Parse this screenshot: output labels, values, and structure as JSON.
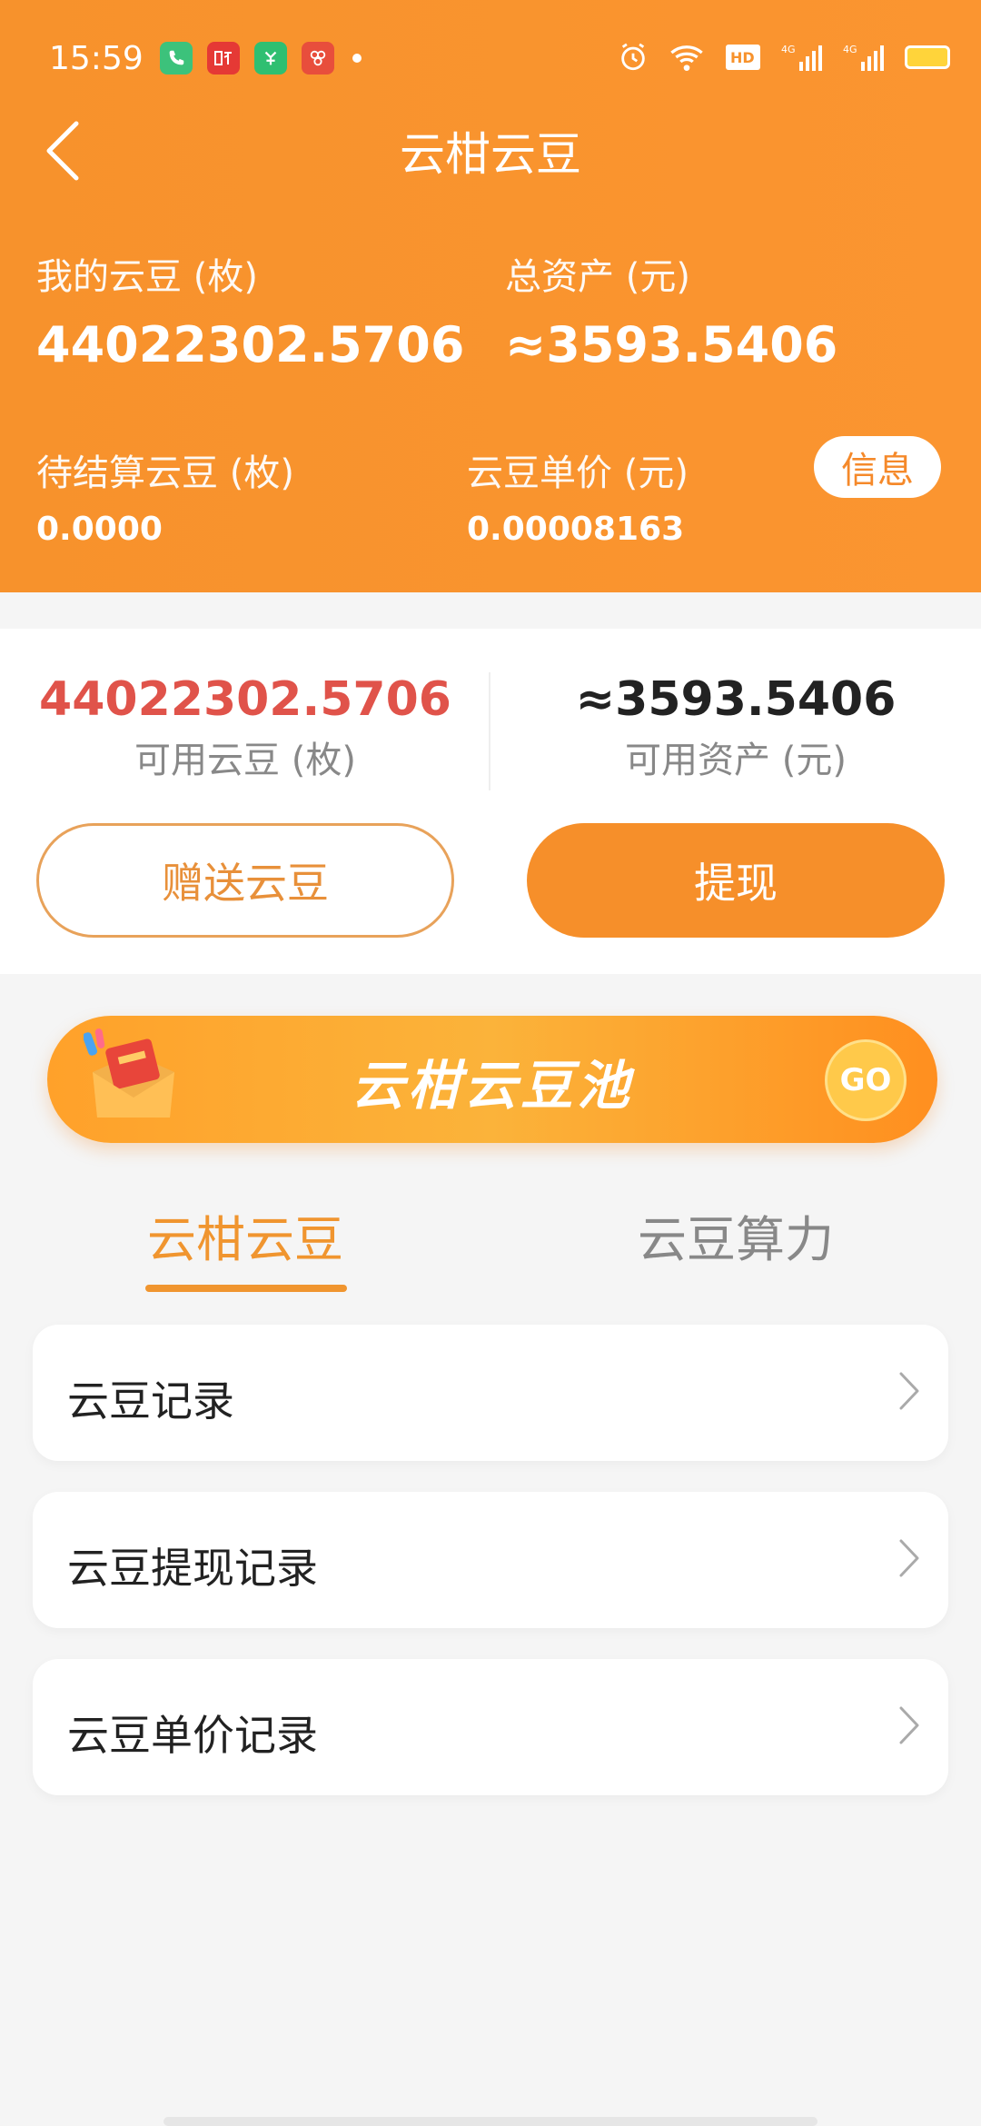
{
  "status_bar": {
    "time": "15:59",
    "app_icons": [
      "phone-icon",
      "listen-icon",
      "green-app-icon",
      "red-app-icon"
    ],
    "system_icons": [
      "alarm-icon",
      "wifi-icon",
      "hd-icon",
      "4g-signal-icon",
      "4g-signal-icon",
      "battery-icon"
    ]
  },
  "nav": {
    "title": "云柑云豆"
  },
  "header": {
    "my_beans_label": "我的云豆 (枚)",
    "my_beans_value": "44022302.5706",
    "total_assets_label": "总资产 (元)",
    "total_assets_value": "≈3593.5406",
    "pending_label": "待结算云豆 (枚)",
    "pending_value": "0.0000",
    "unit_price_label": "云豆单价 (元)",
    "unit_price_value": "0.00008163",
    "info_button": "信息"
  },
  "balance": {
    "available_beans_value": "44022302.5706",
    "available_beans_label": "可用云豆 (枚)",
    "available_assets_value": "≈3593.5406",
    "available_assets_label": "可用资产 (元)",
    "gift_button": "赠送云豆",
    "withdraw_button": "提现"
  },
  "banner": {
    "title": "云柑云豆池",
    "go_label": "GO"
  },
  "tabs": [
    {
      "label": "云柑云豆",
      "active": true
    },
    {
      "label": "云豆算力",
      "active": false
    }
  ],
  "list": [
    {
      "label": "云豆记录"
    },
    {
      "label": "云豆提现记录"
    },
    {
      "label": "云豆单价记录"
    }
  ],
  "colors": {
    "header_orange": "#f7922c",
    "accent_orange": "#f0952f",
    "red_value": "#e0534a"
  }
}
